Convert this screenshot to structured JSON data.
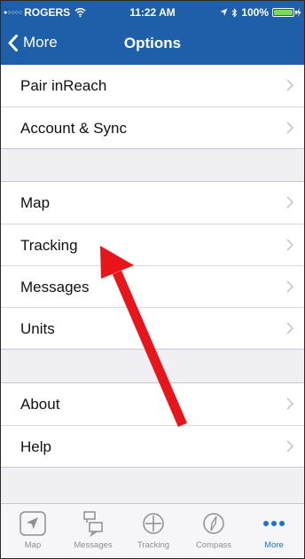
{
  "status_bar": {
    "carrier": "ROGERS",
    "time": "11:22 AM",
    "battery": "100%",
    "battery_level": 1.0,
    "icons": [
      "signal-dots-icon",
      "wifi-icon",
      "location-arrow-icon",
      "bluetooth-icon",
      "battery-icon",
      "charging-icon"
    ]
  },
  "navbar": {
    "back_label": "More",
    "title": "Options"
  },
  "groups": [
    {
      "items": [
        {
          "label": "Pair inReach"
        },
        {
          "label": "Account & Sync"
        }
      ]
    },
    {
      "items": [
        {
          "label": "Map"
        },
        {
          "label": "Tracking"
        },
        {
          "label": "Messages"
        },
        {
          "label": "Units"
        }
      ]
    },
    {
      "items": [
        {
          "label": "About"
        },
        {
          "label": "Help"
        }
      ]
    }
  ],
  "annotation": {
    "color": "#e8161b",
    "points_to": "Tracking"
  },
  "tabbar": {
    "tabs": [
      {
        "label": "Map",
        "icon": "location-arrow-icon"
      },
      {
        "label": "Messages",
        "icon": "messages-icon"
      },
      {
        "label": "Tracking",
        "icon": "tracking-icon"
      },
      {
        "label": "Compass",
        "icon": "compass-icon"
      },
      {
        "label": "More",
        "icon": "more-dots-icon",
        "active": true
      }
    ]
  },
  "colors": {
    "header": "#1d5fa8",
    "active_tab": "#1d6fd6",
    "background": "#efeff4"
  }
}
